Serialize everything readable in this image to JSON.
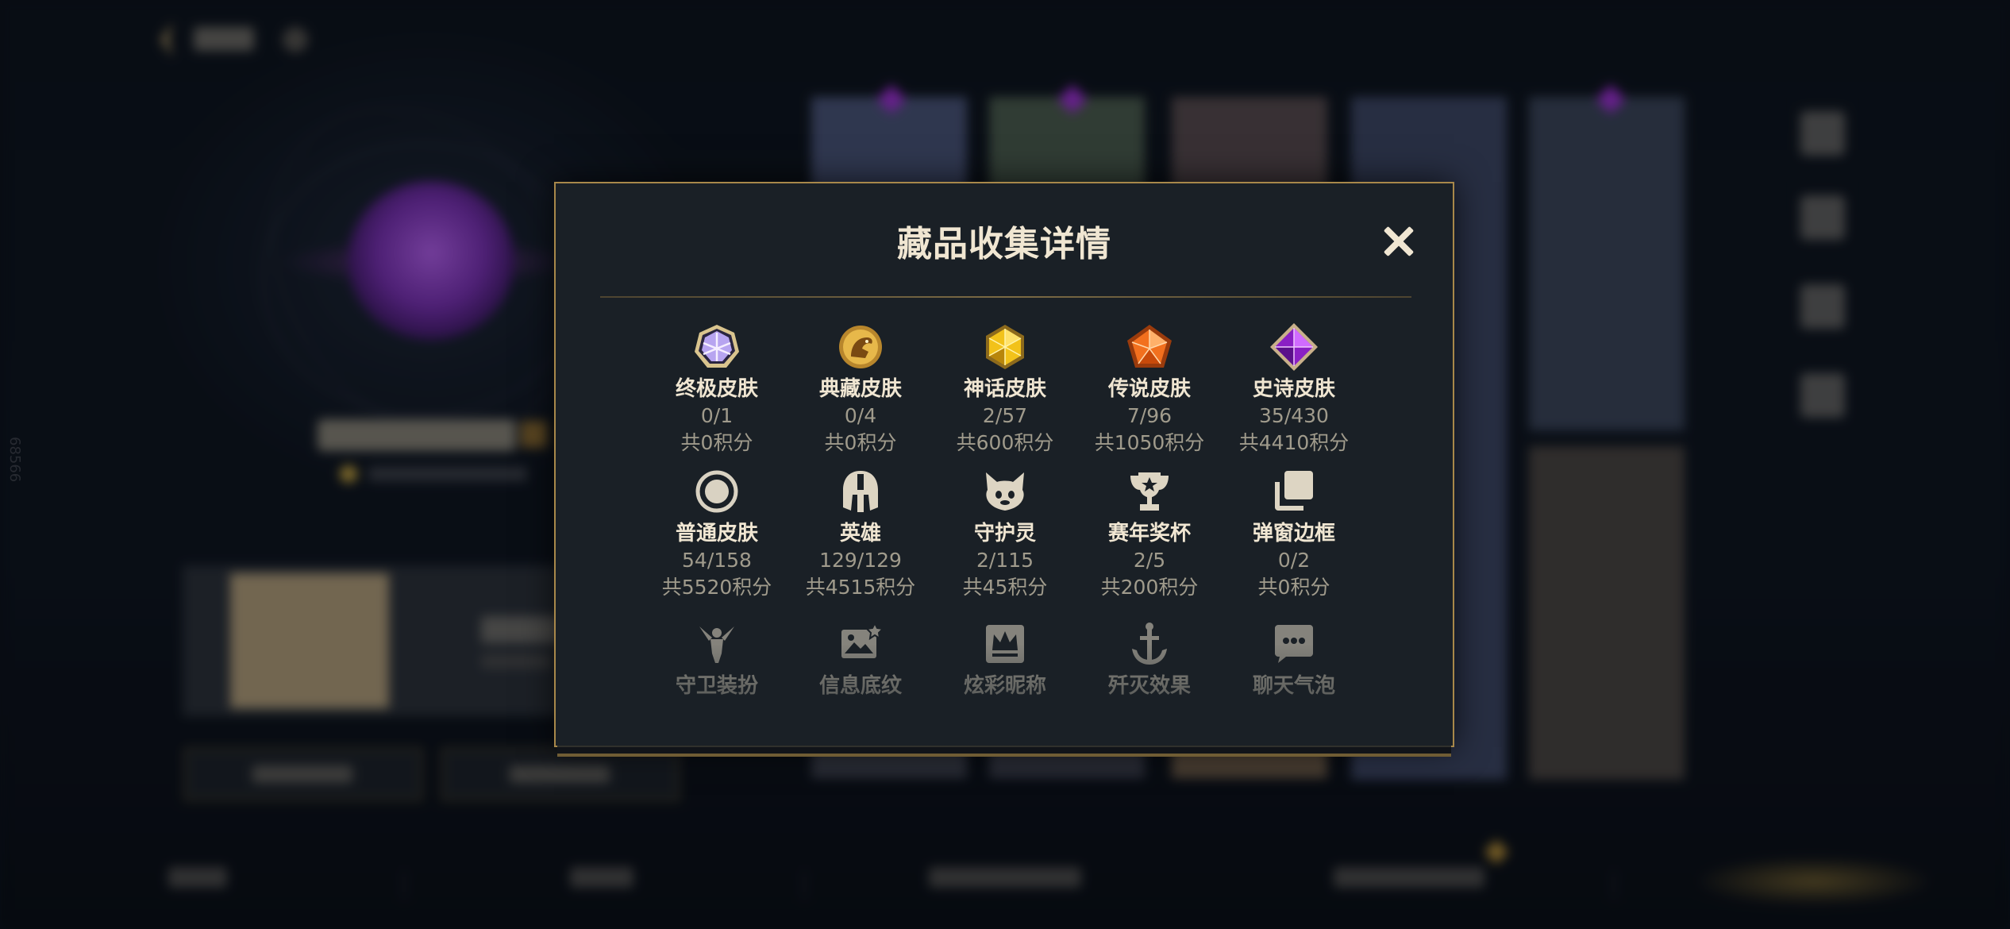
{
  "background": {
    "side_number": "68566"
  },
  "modal": {
    "title": "藏品收集详情",
    "close_icon": "close-icon",
    "rows": [
      [
        {
          "key": "ultimate",
          "icon": "ultimate-skin-icon",
          "name": "终极皮肤",
          "count": "0/1",
          "points": "共0积分"
        },
        {
          "key": "prestige",
          "icon": "prestige-skin-icon",
          "name": "典藏皮肤",
          "count": "0/4",
          "points": "共0积分"
        },
        {
          "key": "mythic",
          "icon": "mythic-skin-icon",
          "name": "神话皮肤",
          "count": "2/57",
          "points": "共600积分"
        },
        {
          "key": "legendary",
          "icon": "legendary-skin-icon",
          "name": "传说皮肤",
          "count": "7/96",
          "points": "共1050积分"
        },
        {
          "key": "epic",
          "icon": "epic-skin-icon",
          "name": "史诗皮肤",
          "count": "35/430",
          "points": "共4410积分"
        }
      ],
      [
        {
          "key": "standard",
          "icon": "standard-skin-icon",
          "name": "普通皮肤",
          "count": "54/158",
          "points": "共5520积分"
        },
        {
          "key": "champion",
          "icon": "champion-helmet-icon",
          "name": "英雄",
          "count": "129/129",
          "points": "共4515积分"
        },
        {
          "key": "ward",
          "icon": "ward-spirit-icon",
          "name": "守护灵",
          "count": "2/115",
          "points": "共45积分"
        },
        {
          "key": "trophy",
          "icon": "trophy-icon",
          "name": "赛年奖杯",
          "count": "2/5",
          "points": "共200积分"
        },
        {
          "key": "frame",
          "icon": "popup-frame-icon",
          "name": "弹窗边框",
          "count": "0/2",
          "points": "共0积分"
        }
      ],
      [
        {
          "key": "guardian",
          "icon": "guardian-outfit-icon",
          "name": "守卫装扮"
        },
        {
          "key": "banner",
          "icon": "info-banner-icon",
          "name": "信息底纹"
        },
        {
          "key": "nickname",
          "icon": "colorful-nickname-icon",
          "name": "炫彩昵称"
        },
        {
          "key": "ace",
          "icon": "ace-effect-icon",
          "name": "歼灭效果"
        },
        {
          "key": "chat",
          "icon": "chat-bubble-icon",
          "name": "聊天气泡"
        }
      ]
    ]
  },
  "colors": {
    "gold_border": "#a8884a",
    "title_text": "#f0e6d2",
    "secondary_text": "#a09b8c",
    "modal_bg": "#1a2026"
  }
}
